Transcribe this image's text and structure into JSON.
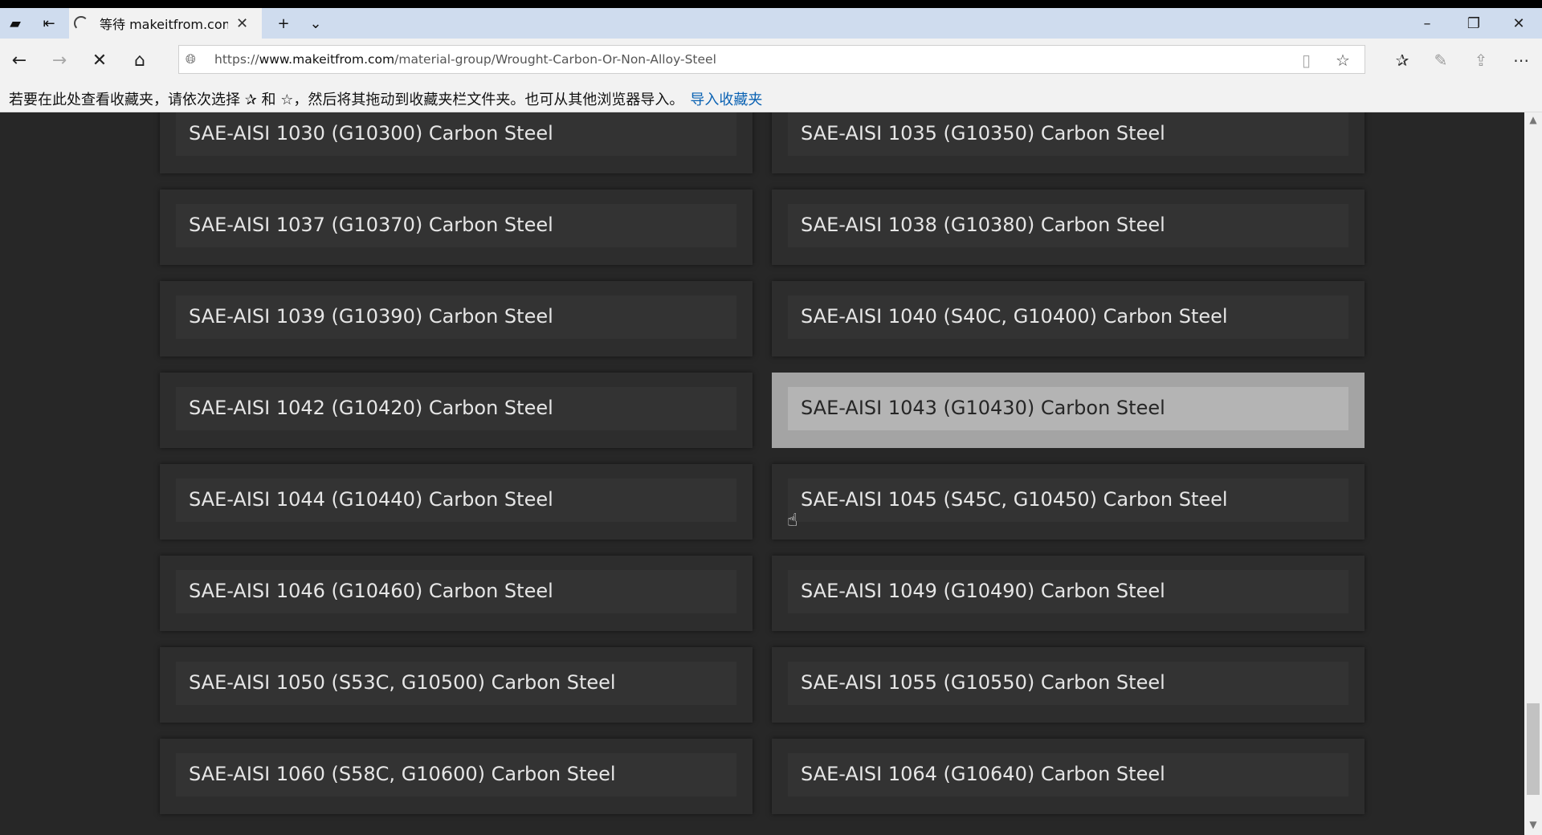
{
  "tab": {
    "title": "等待 makeitfrom.com 的"
  },
  "url": {
    "scheme": "https://",
    "host": "www.makeitfrom.com",
    "path": "/material-group/Wrought-Carbon-Or-Non-Alloy-Steel"
  },
  "favbar": {
    "text": "若要在此处查看收藏夹，请依次选择 ✰ 和 ☆，然后将其拖动到收藏夹栏文件夹。也可从其他浏览器导入。",
    "import_link": "导入收藏夹"
  },
  "materials": [
    "SAE-AISI 1030 (G10300) Carbon Steel",
    "SAE-AISI 1035 (G10350) Carbon Steel",
    "SAE-AISI 1037 (G10370) Carbon Steel",
    "SAE-AISI 1038 (G10380) Carbon Steel",
    "SAE-AISI 1039 (G10390) Carbon Steel",
    "SAE-AISI 1040 (S40C, G10400) Carbon Steel",
    "SAE-AISI 1042 (G10420) Carbon Steel",
    "SAE-AISI 1043 (G10430) Carbon Steel",
    "SAE-AISI 1044 (G10440) Carbon Steel",
    "SAE-AISI 1045 (S45C, G10450) Carbon Steel",
    "SAE-AISI 1046 (G10460) Carbon Steel",
    "SAE-AISI 1049 (G10490) Carbon Steel",
    "SAE-AISI 1050 (S53C, G10500) Carbon Steel",
    "SAE-AISI 1055 (G10550) Carbon Steel",
    "SAE-AISI 1060 (S58C, G10600) Carbon Steel",
    "SAE-AISI 1064 (G10640) Carbon Steel"
  ],
  "hovered_index": 7,
  "icons": {
    "tab_actions": "tab-actions-icon",
    "set_aside": "set-aside-tabs-icon",
    "loading": "loading-spinner-icon",
    "close_tab": "close-icon",
    "new_tab": "plus-icon",
    "tab_list": "chevron-down-icon",
    "minimize": "minimize-icon",
    "restore": "restore-icon",
    "close_window": "close-window-icon",
    "back": "back-arrow-icon",
    "forward": "forward-arrow-icon",
    "stop": "stop-loading-icon",
    "home": "home-icon",
    "site_info": "globe-icon",
    "reading_view": "reading-view-icon",
    "favorite": "star-icon",
    "favorites_hub": "favorites-list-icon",
    "web_note": "pen-icon",
    "share": "share-icon",
    "more": "more-icon"
  },
  "colors": {
    "page_bg": "#272727",
    "card_bg": "#2d2d2d",
    "card_inner": "#333333",
    "card_text": "#e6e6e6",
    "hover_bg": "#a4a4a4",
    "link": "#0a62b3"
  }
}
